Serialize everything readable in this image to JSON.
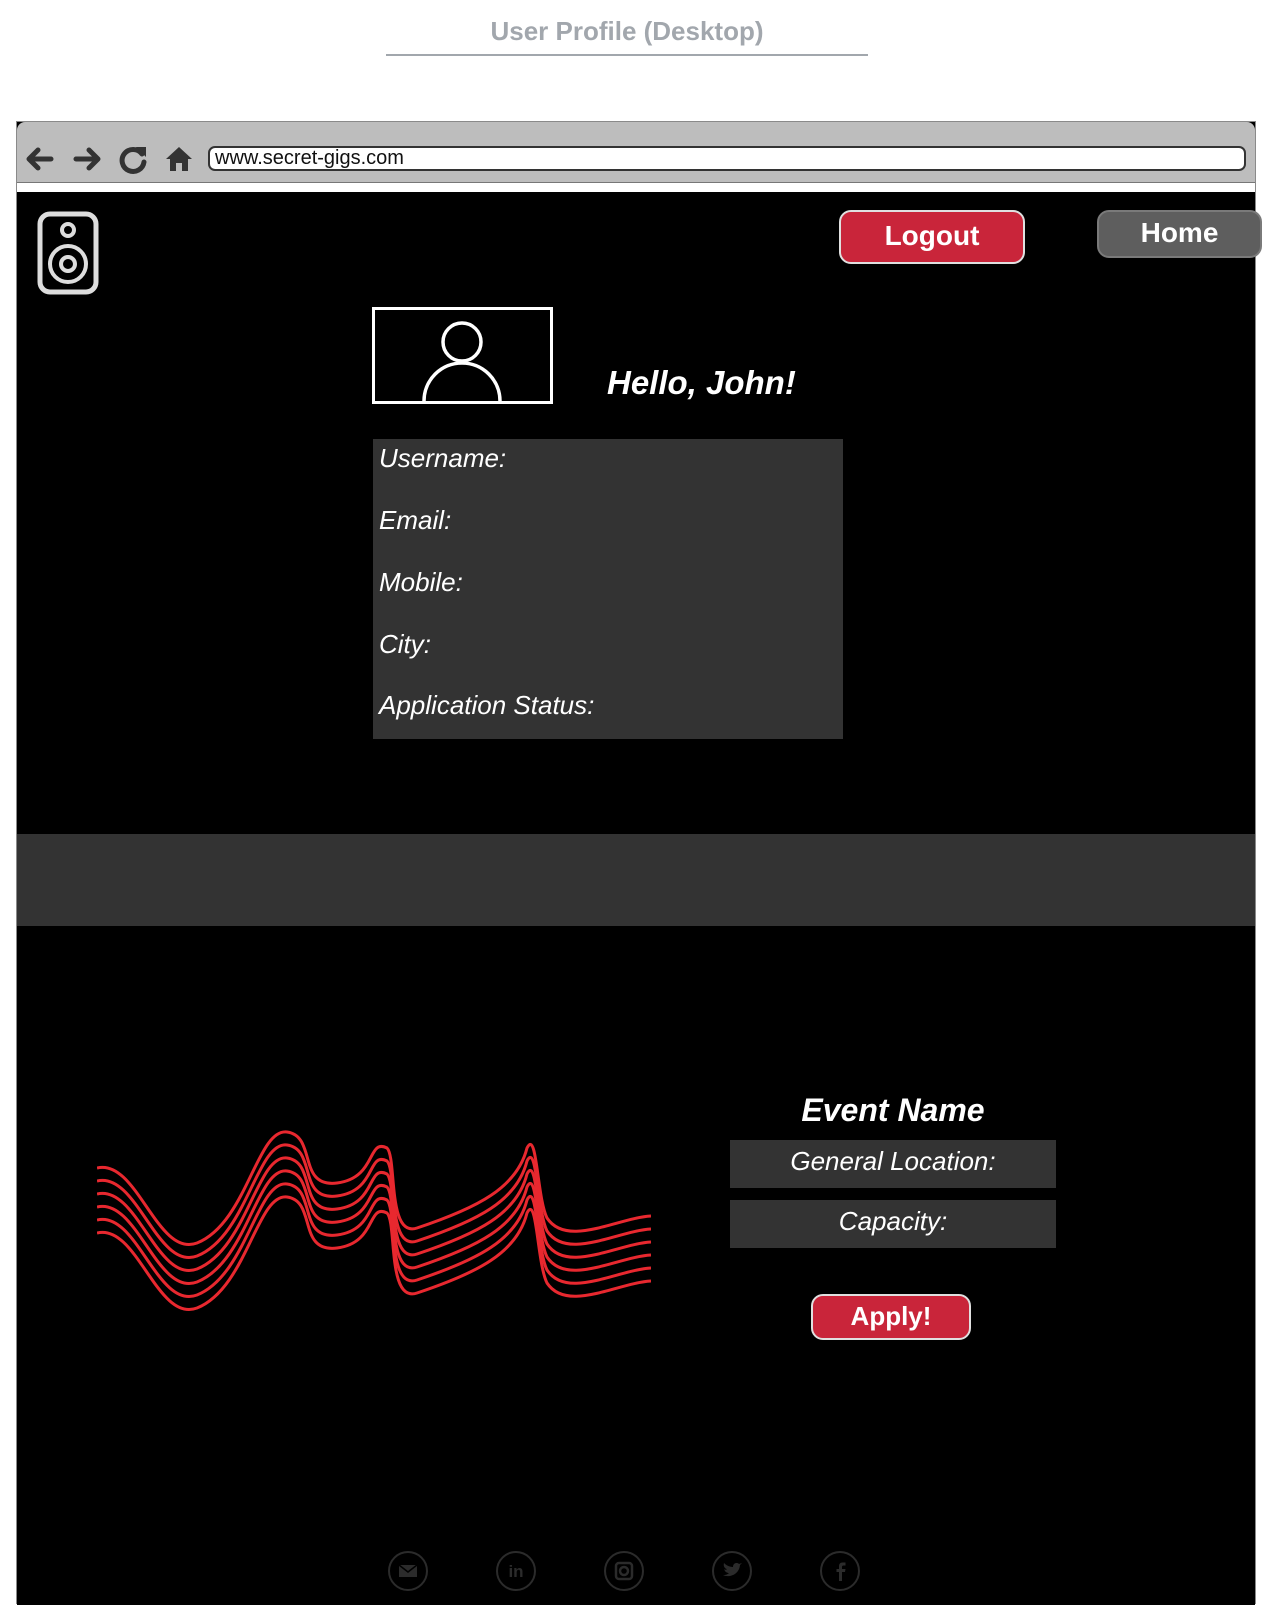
{
  "document": {
    "title": "User Profile (Desktop)"
  },
  "browser": {
    "url": "www.secret-gigs.com",
    "nav_icons": [
      "back-arrow-icon",
      "forward-arrow-icon",
      "refresh-icon",
      "home-icon"
    ]
  },
  "header": {
    "logo_icon": "speaker-icon",
    "logout_label": "Logout",
    "home_label": "Home",
    "accent_color": "#c9253a"
  },
  "profile": {
    "avatar_icon": "user-placeholder-icon",
    "greeting": "Hello, John!",
    "fields": [
      {
        "label": "Username:"
      },
      {
        "label": "Email:"
      },
      {
        "label": "Mobile:"
      },
      {
        "label": "City:"
      },
      {
        "label": "Application Status:"
      }
    ]
  },
  "event": {
    "image_icon": "red-sound-wave-graphic",
    "name": "Event Name",
    "location_label": "General Location:",
    "capacity_label": "Capacity:",
    "apply_label": "Apply!"
  },
  "footer": {
    "social_icons": [
      "email-icon",
      "linkedin-icon",
      "instagram-icon",
      "twitter-icon",
      "facebook-icon"
    ]
  }
}
